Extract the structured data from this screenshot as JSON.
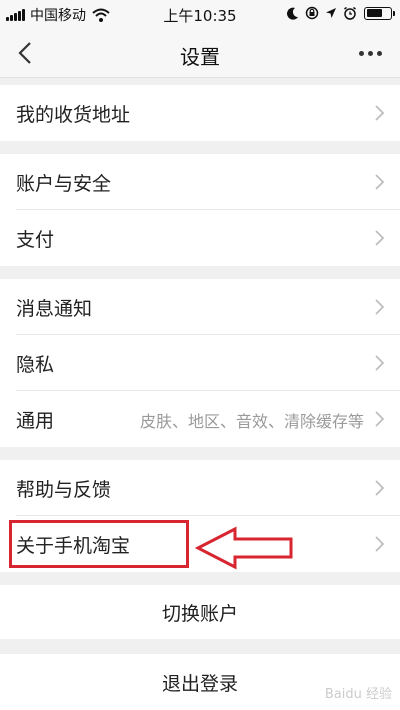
{
  "status_bar": {
    "carrier": "中国移动",
    "time": "上午10:35",
    "icons": [
      "signal-icon",
      "wifi-icon",
      "moon-icon",
      "rotation-lock-icon",
      "location-icon",
      "alarm-icon",
      "battery-icon"
    ],
    "battery_level": 0.7
  },
  "nav": {
    "title": "设置",
    "back_icon": "chevron-left-icon",
    "more_icon": "more-dots-icon"
  },
  "sections": {
    "address": "我的收货地址",
    "account_security": "账户与安全",
    "payment": "支付",
    "notifications": "消息通知",
    "privacy": "隐私",
    "general": "通用",
    "general_value": "皮肤、地区、音效、清除缓存等",
    "help_feedback": "帮助与反馈",
    "about": "关于手机淘宝"
  },
  "actions": {
    "switch_account": "切换账户",
    "logout": "退出登录"
  },
  "watermark": {
    "text": "Baidu 经验"
  },
  "colors": {
    "annotation": "#d7262f",
    "background": "#f0f0f0",
    "row": "#ffffff",
    "secondary_text": "#9a9a9a"
  }
}
